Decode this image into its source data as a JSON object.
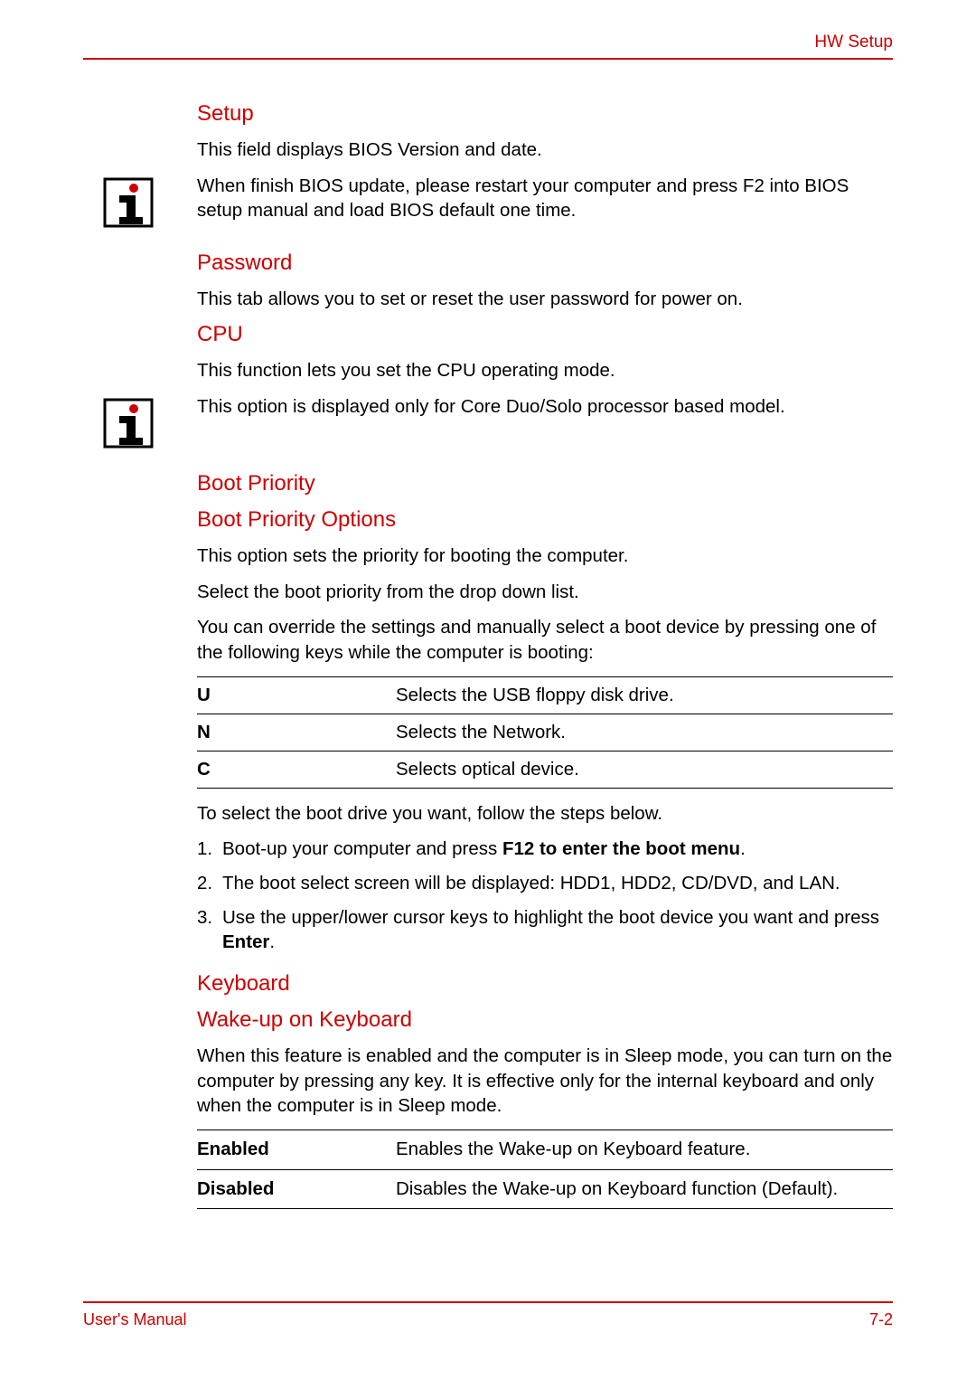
{
  "header": {
    "title": "HW Setup"
  },
  "sections": {
    "setup": {
      "heading": "Setup",
      "body": "This field displays BIOS Version and date.",
      "info": "When finish BIOS update, please restart your computer and press F2 into BIOS setup manual and load BIOS default one time."
    },
    "password": {
      "heading": "Password",
      "body": "This tab allows you to set or reset the user password for power on."
    },
    "cpu": {
      "heading": "CPU",
      "body": "This function lets you set the CPU operating mode.",
      "info": "This option is displayed only for Core Duo/Solo processor based model."
    },
    "boot": {
      "heading": "Boot Priority",
      "subheading": "Boot Priority Options",
      "p1": "This option sets the priority for booting the computer.",
      "p2": "Select the boot priority from the drop down list.",
      "p3": "You can override the settings and manually select a boot device by pressing one of the following keys while the computer is booting:",
      "keys": [
        {
          "key": "U",
          "desc": "Selects the USB floppy disk drive."
        },
        {
          "key": "N",
          "desc": "Selects the Network."
        },
        {
          "key": "C",
          "desc": "Selects optical device."
        }
      ],
      "p4": "To select the boot drive you want, follow the steps below.",
      "steps": {
        "s1a": "Boot-up your computer and press ",
        "s1b": "F12 to enter the boot menu",
        "s1c": ".",
        "s2": "The boot select screen will be displayed: HDD1, HDD2, CD/DVD, and LAN.",
        "s3a": "Use the upper/lower cursor keys to highlight the boot device you want and press ",
        "s3b": "Enter",
        "s3c": "."
      }
    },
    "keyboard": {
      "heading": "Keyboard",
      "subheading": "Wake-up on Keyboard",
      "body": "When this feature is enabled and the computer is in Sleep mode, you can turn on the computer by pressing any key. It is effective only for the internal keyboard and only when the computer is in Sleep mode.",
      "options": [
        {
          "name": "Enabled",
          "desc": "Enables the Wake-up on Keyboard feature."
        },
        {
          "name": "Disabled",
          "desc": "Disables the Wake-up on Keyboard function (Default)."
        }
      ]
    }
  },
  "footer": {
    "left": "User's Manual",
    "right": "7-2"
  }
}
